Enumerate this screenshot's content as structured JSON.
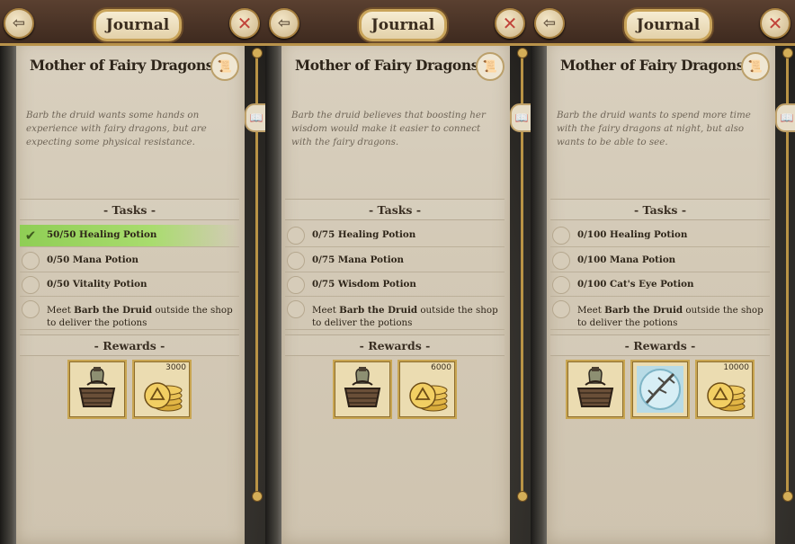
{
  "journal_title": "Journal",
  "panels": [
    {
      "quest_title": "Mother of Fairy Dragons",
      "description": "Barb the druid wants some hands on experience with fairy dragons, but are expecting some physical resistance.",
      "tasks_label": "- Tasks -",
      "tasks": [
        {
          "text": "50/50 Healing Potion",
          "done": true
        },
        {
          "text": "0/50 Mana Potion",
          "done": false
        },
        {
          "text": "0/50 Vitality Potion",
          "done": false
        }
      ],
      "meet": {
        "pre": "Meet ",
        "name": "Barb the Druid",
        "post": " outside the shop to deliver the potions"
      },
      "rewards_label": "- Rewards -",
      "rewards": [
        {
          "icon": "potion-basket-icon",
          "qty": ""
        },
        {
          "icon": "gold-coins-icon",
          "qty": "3000"
        }
      ]
    },
    {
      "quest_title": "Mother of Fairy Dragons",
      "description": "Barb the druid believes that boosting her wisdom would make it easier to connect with the fairy dragons.",
      "tasks_label": "- Tasks -",
      "tasks": [
        {
          "text": "0/75 Healing Potion",
          "done": false
        },
        {
          "text": "0/75 Mana Potion",
          "done": false
        },
        {
          "text": "0/75 Wisdom Potion",
          "done": false
        }
      ],
      "meet": {
        "pre": "Meet ",
        "name": "Barb the Druid",
        "post": " outside the shop to deliver the potions"
      },
      "rewards_label": "- Rewards -",
      "rewards": [
        {
          "icon": "potion-basket-icon",
          "qty": ""
        },
        {
          "icon": "gold-coins-icon",
          "qty": "6000"
        }
      ]
    },
    {
      "quest_title": "Mother of Fairy Dragons",
      "description": "Barb the druid wants to spend more time with the fairy dragons at night, but also wants to be able to see.",
      "tasks_label": "- Tasks -",
      "tasks": [
        {
          "text": "0/100 Healing Potion",
          "done": false
        },
        {
          "text": "0/100 Mana Potion",
          "done": false
        },
        {
          "text": "0/100 Cat's Eye Potion",
          "done": false
        }
      ],
      "meet": {
        "pre": "Meet ",
        "name": "Barb the Druid",
        "post": " outside the shop to deliver the potions"
      },
      "rewards_label": "- Rewards -",
      "rewards": [
        {
          "icon": "potion-basket-icon",
          "qty": ""
        },
        {
          "icon": "frost-branch-icon",
          "qty": ""
        },
        {
          "icon": "gold-coins-icon",
          "qty": "10000"
        }
      ]
    }
  ],
  "colors": {
    "task_done": "#a9dc6e",
    "frame_gold": "#c8a551",
    "paper": "#d6cdbb"
  }
}
